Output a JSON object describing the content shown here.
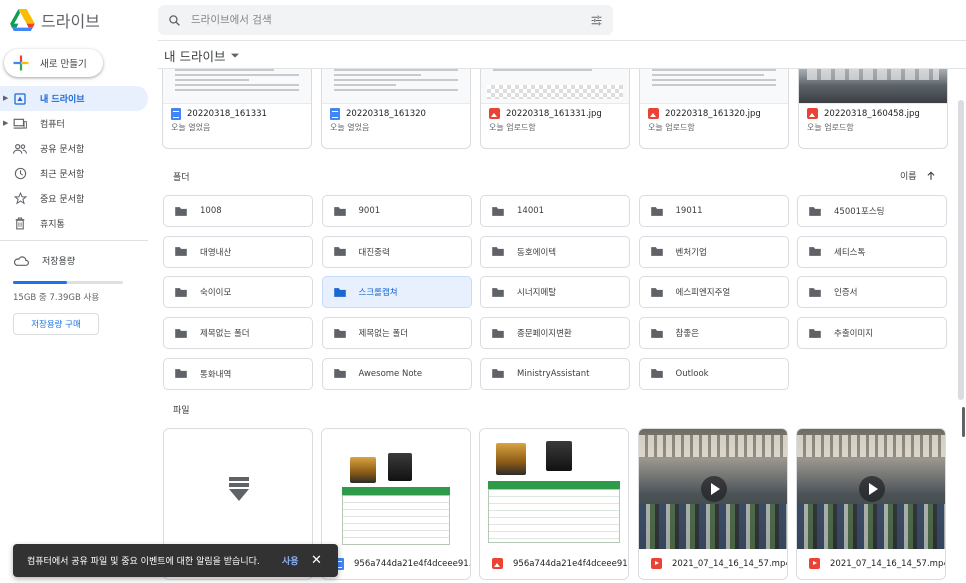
{
  "app": {
    "name": "드라이브"
  },
  "search": {
    "placeholder": "드라이브에서 검색"
  },
  "sidebar": {
    "new_label": "새로 만들기",
    "items": [
      {
        "label": "내 드라이브",
        "icon": "my-drive-icon",
        "active": true
      },
      {
        "label": "컴퓨터",
        "icon": "computer-icon"
      },
      {
        "label": "공유 문서함",
        "icon": "shared-icon"
      },
      {
        "label": "최근 문서함",
        "icon": "clock-icon"
      },
      {
        "label": "중요 문서함",
        "icon": "star-icon"
      },
      {
        "label": "휴지통",
        "icon": "trash-icon"
      }
    ],
    "storage": {
      "label": "저장용량",
      "usage_text": "15GB 중 7.39GB 사용",
      "used_fraction": 0.49,
      "buy_label": "저장용량 구매"
    }
  },
  "main": {
    "breadcrumb": "내 드라이브",
    "recent": [
      {
        "name": "20220318_161331",
        "sub": "오늘 열었음",
        "type": "doc"
      },
      {
        "name": "20220318_161320",
        "sub": "오늘 열었음",
        "type": "doc"
      },
      {
        "name": "20220318_161331.jpg",
        "sub": "오늘 업로드함",
        "type": "image"
      },
      {
        "name": "20220318_161320.jpg",
        "sub": "오늘 업로드함",
        "type": "image"
      },
      {
        "name": "20220318_160458.jpg",
        "sub": "오늘 업로드함",
        "type": "image"
      }
    ],
    "folders_label": "폴더",
    "sort_label": "이름",
    "folders": [
      "1008",
      "9001",
      "14001",
      "19011",
      "45001포스팅",
      "대영내산",
      "대진중력",
      "동호에이텍",
      "벤처기업",
      "세티스톡",
      "숙이이모",
      "스크롤캡쳐",
      "시너지메탈",
      "에스피엔지주얼",
      "인증서",
      "제목없는 폴더",
      "제목없는 폴더",
      "종문페이지변환",
      "참좋은",
      "추출이미지",
      "통화내역",
      "Awesome Note",
      "MinistryAssistant",
      "Outlook"
    ],
    "selected_folder_index": 11,
    "files_label": "파일",
    "files": [
      {
        "name": "",
        "type": "unknown"
      },
      {
        "name": "956a744da21e4f4dceee91...",
        "type": "doc"
      },
      {
        "name": "956a744da21e4f4dceee91...",
        "type": "image"
      },
      {
        "name": "2021_07_14_16_14_57.mp4",
        "type": "video"
      },
      {
        "name": "2021_07_14_16_14_57.mp4",
        "type": "video"
      }
    ]
  },
  "toast": {
    "message": "컴퓨터에서 공유 파일 및 중요 이벤트에 대한 알림을 받습니다.",
    "action": "사용",
    "close": "✕"
  },
  "colors": {
    "accent": "#1a73e8",
    "active_bg": "#e8f0fe",
    "folder_icon": "#5f6368",
    "toast_bg": "#323232"
  }
}
